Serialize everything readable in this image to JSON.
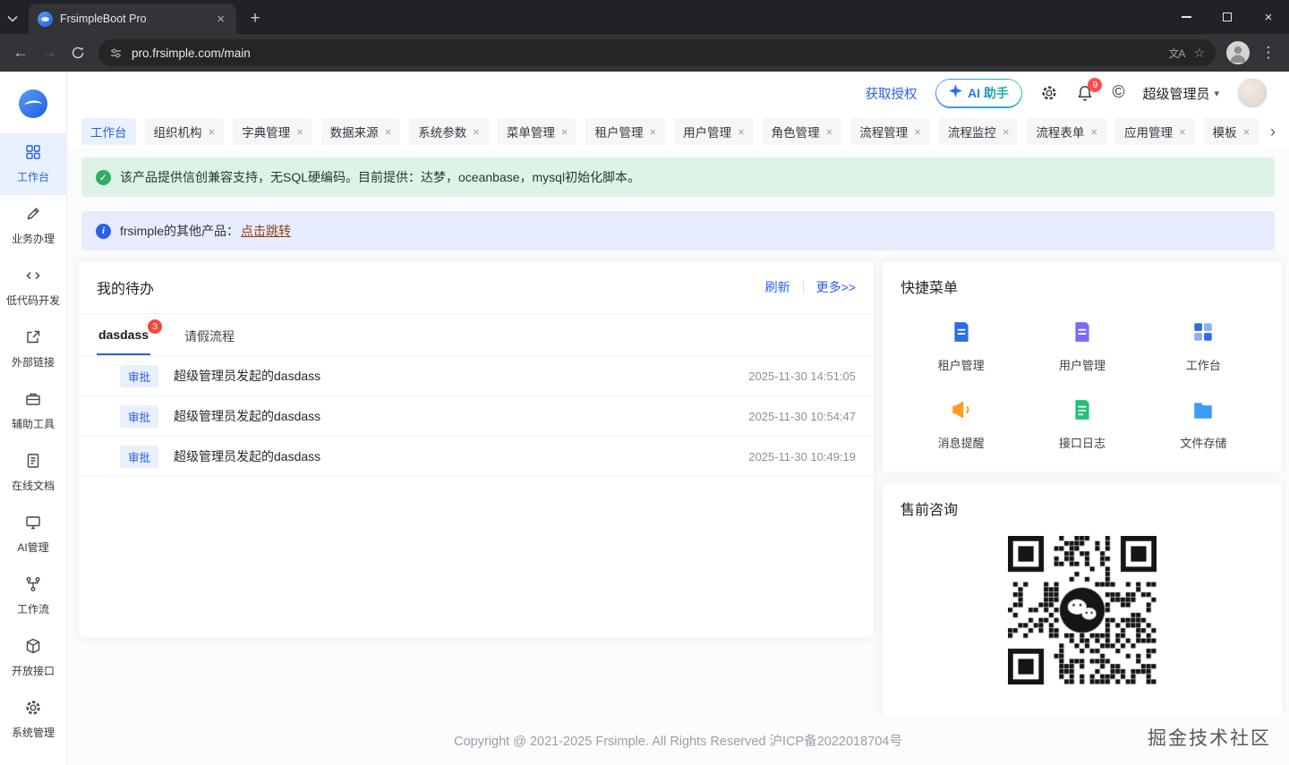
{
  "browser": {
    "tab_title": "FrsimpleBoot Pro",
    "url": "pro.frsimple.com/main"
  },
  "icons": {
    "tab_close": "×",
    "new_tab": "+",
    "close_window": "×",
    "back": "←",
    "forward": "→",
    "menu": "⋮",
    "star": "☆",
    "caret_down": "▾",
    "copyright": "©",
    "chevron_right": "›",
    "check": "✓",
    "info": "i",
    "translate": "文A"
  },
  "colors": {
    "accent": "#2b5fe8",
    "success": "#2fae64",
    "danger": "#f5483b"
  },
  "header": {
    "license_link": "获取授权",
    "ai_button": "AI 助手",
    "notification_count": "9",
    "user_role": "超级管理员"
  },
  "sidebar": {
    "items": [
      {
        "label": "工作台",
        "icon": "workbench-grid",
        "active": true
      },
      {
        "label": "业务办理",
        "icon": "pencil"
      },
      {
        "label": "低代码开发",
        "icon": "code"
      },
      {
        "label": "外部链接",
        "icon": "external-link"
      },
      {
        "label": "辅助工具",
        "icon": "toolbox"
      },
      {
        "label": "在线文档",
        "icon": "document"
      },
      {
        "label": "AI管理",
        "icon": "monitor"
      },
      {
        "label": "工作流",
        "icon": "workflow"
      },
      {
        "label": "开放接口",
        "icon": "cube"
      },
      {
        "label": "系统管理",
        "icon": "gear"
      }
    ]
  },
  "tabs": {
    "items": [
      {
        "label": "工作台",
        "active": true
      },
      {
        "label": "组织机构"
      },
      {
        "label": "字典管理"
      },
      {
        "label": "数据来源"
      },
      {
        "label": "系统参数"
      },
      {
        "label": "菜单管理"
      },
      {
        "label": "租户管理"
      },
      {
        "label": "用户管理"
      },
      {
        "label": "角色管理"
      },
      {
        "label": "流程管理"
      },
      {
        "label": "流程监控"
      },
      {
        "label": "流程表单"
      },
      {
        "label": "应用管理"
      },
      {
        "label": "模板"
      }
    ]
  },
  "alerts": {
    "success": "该产品提供信创兼容支持，无SQL硬编码。目前提供：达梦，oceanbase，mysql初始化脚本。",
    "info_prefix": "frsimple的其他产品：",
    "info_link": "点击跳转"
  },
  "todo": {
    "title": "我的待办",
    "refresh": "刷新",
    "more": "更多>>",
    "tabs": [
      {
        "label": "dasdass",
        "badge": "3",
        "active": true
      },
      {
        "label": "请假流程"
      }
    ],
    "items": [
      {
        "tag": "审批",
        "title": "超级管理员发起的dasdass",
        "time": "2025-11-30 14:51:05"
      },
      {
        "tag": "审批",
        "title": "超级管理员发起的dasdass",
        "time": "2025-11-30 10:54:47"
      },
      {
        "tag": "审批",
        "title": "超级管理员发起的dasdass",
        "time": "2025-11-30 10:49:19"
      }
    ]
  },
  "quick_menu": {
    "title": "快捷菜单",
    "items": [
      {
        "label": "租户管理",
        "color": "#2b6de8",
        "icon": "doc"
      },
      {
        "label": "用户管理",
        "color": "#7a6bf5",
        "icon": "doc"
      },
      {
        "label": "工作台",
        "color": "#2b6de8",
        "icon": "grid"
      },
      {
        "label": "消息提醒",
        "color": "#ff9b21",
        "icon": "megaphone"
      },
      {
        "label": "接口日志",
        "color": "#21c17a",
        "icon": "doc"
      },
      {
        "label": "文件存储",
        "color": "#3d9cf5",
        "icon": "folder"
      }
    ]
  },
  "consult": {
    "title": "售前咨询"
  },
  "footer": {
    "copyright": "Copyright @ 2021-2025 Frsimple. All Rights Reserved 沪ICP备2022018704号"
  },
  "watermark": "掘金技术社区"
}
